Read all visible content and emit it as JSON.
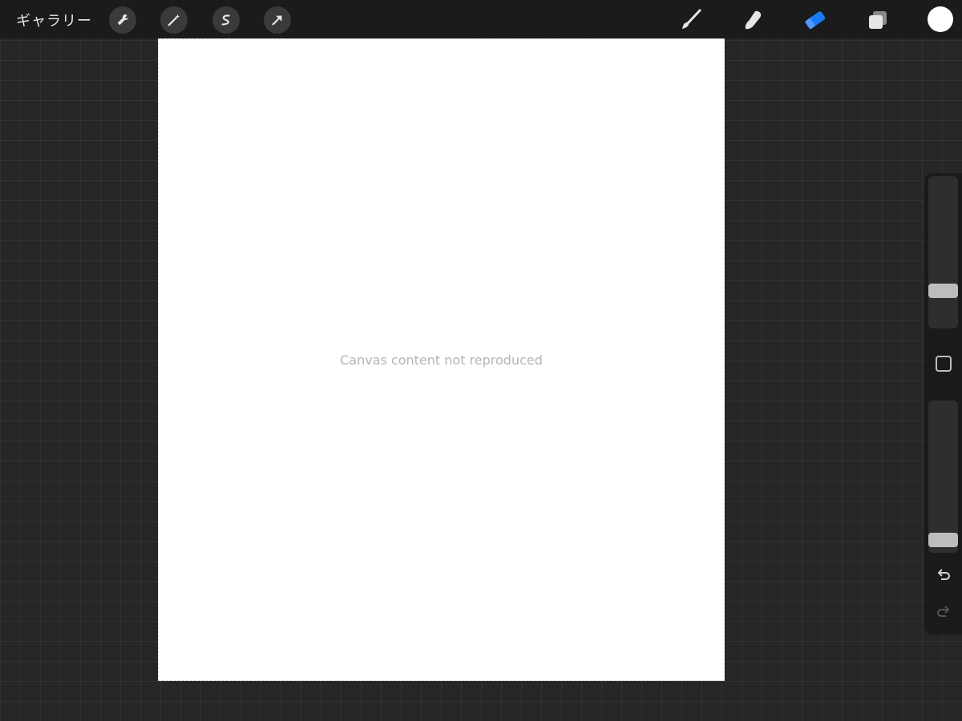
{
  "topbar": {
    "gallery_label": "ギャラリー",
    "left_tools": [
      {
        "icon": "wrench-icon",
        "label": "Actions"
      },
      {
        "icon": "magic-wand-icon",
        "label": "Adjustments"
      },
      {
        "icon": "selection-icon",
        "label": "Selection"
      },
      {
        "icon": "transform-arrow-icon",
        "label": "Transform"
      }
    ],
    "right_tools": [
      {
        "icon": "brush-icon",
        "active": false
      },
      {
        "icon": "smudge-icon",
        "active": false
      },
      {
        "icon": "eraser-icon",
        "active": true
      },
      {
        "icon": "layers-icon",
        "active": false
      }
    ]
  },
  "colors": {
    "active_tool": "#1a7cf5",
    "current_color": "#ffffff",
    "canvas": "#ffffff"
  },
  "canvas": {
    "note": "Canvas content not reproduced"
  },
  "sidebar": {
    "brush_size_level": 0.22,
    "opacity_level": 0.04,
    "undo_icon": "undo-icon",
    "redo_icon": "redo-icon",
    "redo_enabled": false
  }
}
